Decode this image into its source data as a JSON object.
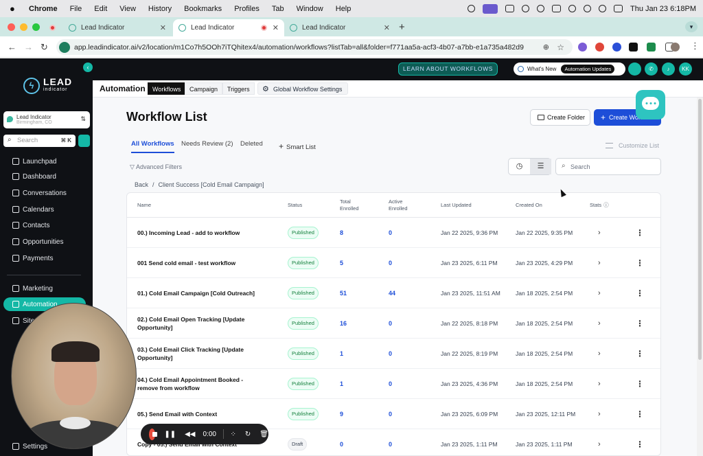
{
  "menubar": {
    "app": "Chrome",
    "items": [
      "File",
      "Edit",
      "View",
      "History",
      "Bookmarks",
      "Profiles",
      "Tab",
      "Window",
      "Help"
    ],
    "clock": "Thu Jan 23  6:18PM"
  },
  "browser": {
    "tabs": [
      {
        "title": "Lead Indicator"
      },
      {
        "title": "Lead Indicator"
      },
      {
        "title": "Lead Indicator"
      }
    ],
    "url": "app.leadindicator.ai/v2/location/m1Co7h5OOh7iTQhitex4/automation/workflows?listTab=all&folder=f771aa5a-acf3-4b07-a7bb-e1a735a482d9"
  },
  "sidebar": {
    "logo_main": "LEAD",
    "logo_sub": "indicator",
    "location_name": "Lead Indicator",
    "location_sub": "Birmingham, CO",
    "search_placeholder": "Search",
    "search_shortcut": "⌘ K",
    "items": [
      {
        "label": "Launchpad"
      },
      {
        "label": "Dashboard"
      },
      {
        "label": "Conversations"
      },
      {
        "label": "Calendars"
      },
      {
        "label": "Contacts"
      },
      {
        "label": "Opportunities"
      },
      {
        "label": "Payments"
      },
      {
        "label": "Marketing"
      },
      {
        "label": "Automation"
      },
      {
        "label": "Sites"
      }
    ],
    "settings_label": "Settings"
  },
  "header": {
    "learn_button": "LEARN ABOUT WORKFLOWS",
    "whats_new": "What's New",
    "updates_pill": "Automation Updates",
    "avatar": "KK"
  },
  "subnav": {
    "title": "Automation",
    "tabs": [
      "Workflows",
      "Campaign",
      "Triggers"
    ],
    "global_settings": "Global Workflow Settings"
  },
  "main": {
    "title": "Workflow List",
    "create_folder": "Create Folder",
    "create_workflow": "Create Workflow",
    "tabs": [
      "All Workflows",
      "Needs Review (2)",
      "Deleted"
    ],
    "smart_list": "Smart List",
    "customize_list": "Customize List",
    "advanced_filters": "Advanced Filters",
    "search_placeholder": "Search",
    "breadcrumb_back": "Back",
    "breadcrumb_sep": "/",
    "breadcrumb_folder": "Client Success [Cold Email Campaign]"
  },
  "table": {
    "headers": {
      "name": "Name",
      "status": "Status",
      "total_enrolled": "Total Enrolled",
      "active_enrolled": "Active Enrolled",
      "last_updated": "Last Updated",
      "created_on": "Created On",
      "stats": "Stats"
    },
    "rows": [
      {
        "name": "00.) Incoming Lead - add to workflow",
        "status": "Published",
        "total": "8",
        "active": "0",
        "updated": "Jan 22 2025, 9:36 PM",
        "created": "Jan 22 2025, 9:35 PM"
      },
      {
        "name": "001 Send cold email - test workflow",
        "status": "Published",
        "total": "5",
        "active": "0",
        "updated": "Jan 23 2025, 6:11 PM",
        "created": "Jan 23 2025, 4:29 PM"
      },
      {
        "name": "01.) Cold Email Campaign [Cold Outreach]",
        "status": "Published",
        "total": "51",
        "active": "44",
        "updated": "Jan 23 2025, 11:51 AM",
        "created": "Jan 18 2025, 2:54 PM"
      },
      {
        "name": "02.) Cold Email Open Tracking [Update Opportunity]",
        "status": "Published",
        "total": "16",
        "active": "0",
        "updated": "Jan 22 2025, 8:18 PM",
        "created": "Jan 18 2025, 2:54 PM"
      },
      {
        "name": "03.) Cold Email Click Tracking [Update Opportunity]",
        "status": "Published",
        "total": "1",
        "active": "0",
        "updated": "Jan 22 2025, 8:19 PM",
        "created": "Jan 18 2025, 2:54 PM"
      },
      {
        "name": "04.) Cold Email Appointment Booked - remove from workflow",
        "status": "Published",
        "total": "1",
        "active": "0",
        "updated": "Jan 23 2025, 4:36 PM",
        "created": "Jan 18 2025, 2:54 PM"
      },
      {
        "name": "05.) Send Email with Context",
        "status": "Published",
        "total": "9",
        "active": "0",
        "updated": "Jan 23 2025, 6:09 PM",
        "created": "Jan 23 2025, 12:11 PM"
      },
      {
        "name": "Copy - 05.) Send Email with Context",
        "status": "Draft",
        "total": "0",
        "active": "0",
        "updated": "Jan 23 2025, 1:11 PM",
        "created": "Jan 23 2025, 1:11 PM"
      }
    ]
  },
  "recorder": {
    "time": "0:00"
  },
  "colors": {
    "accent": "#14b8a6",
    "primary": "#1d4ed8",
    "sidebar_bg": "#0f1115"
  }
}
